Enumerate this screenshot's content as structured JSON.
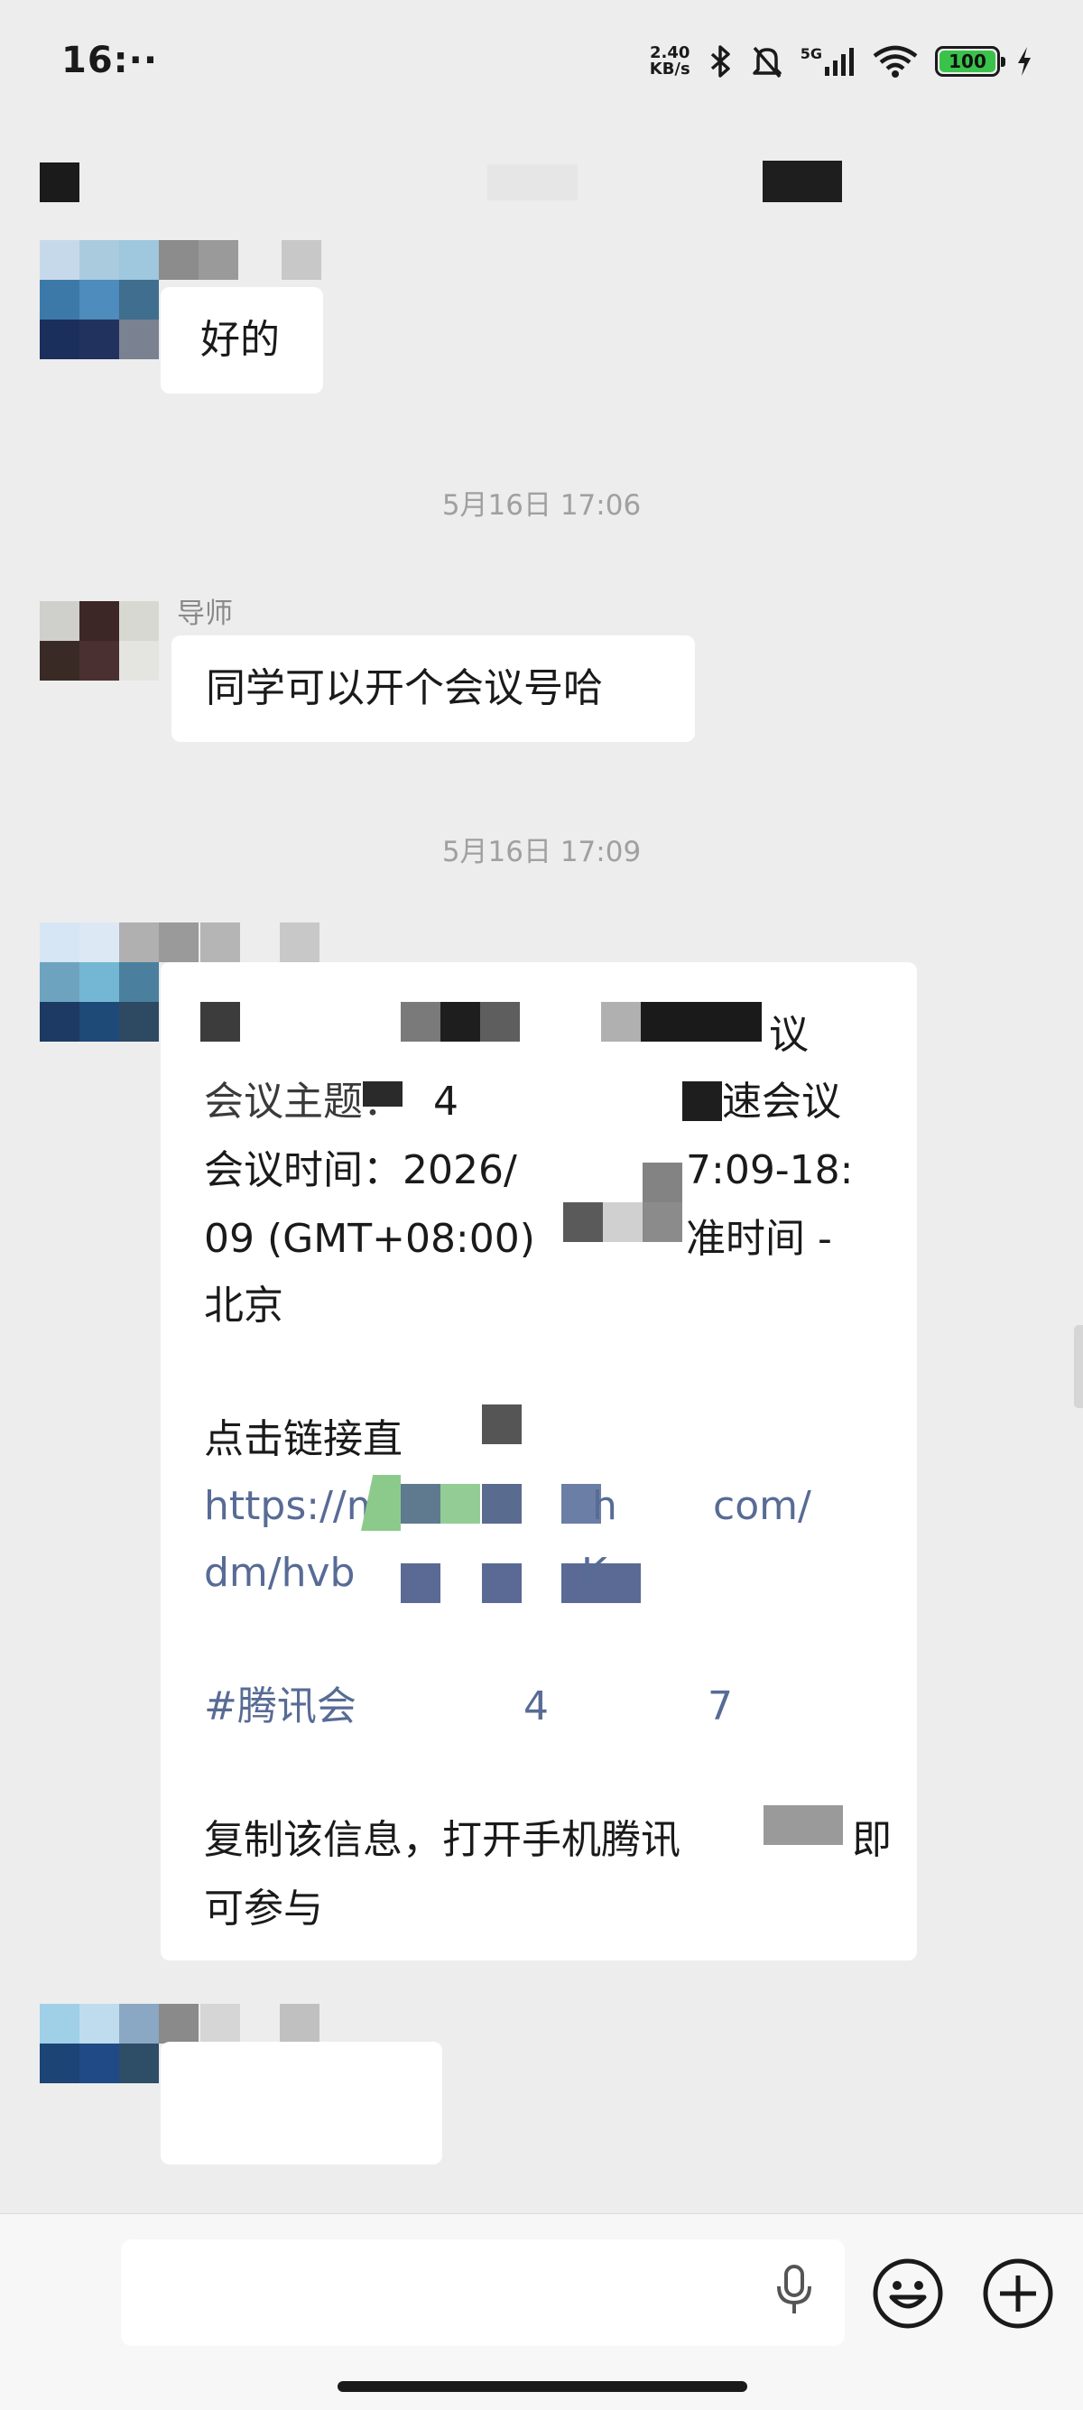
{
  "status_bar": {
    "time": "16:··",
    "net_speed_value": "2.40",
    "net_speed_unit": "KB/s",
    "network": "5G",
    "battery": "100",
    "icons": [
      "bluetooth-icon",
      "mute-bell-icon",
      "signal-icon",
      "wifi-icon",
      "battery-icon",
      "charging-icon"
    ]
  },
  "messages": [
    {
      "type": "text",
      "sender": "other",
      "text": "好的"
    },
    {
      "type": "time",
      "text": "5月16日 17:06"
    },
    {
      "type": "text",
      "sender": "other",
      "name": "导师",
      "text": "同学可以开个会议号哈"
    },
    {
      "type": "time",
      "text": "5月16日 17:09"
    },
    {
      "type": "meeting_card",
      "sender": "other",
      "line1_tail": "议",
      "line2_a": "会议主题：",
      "line2_b": "4",
      "line2_tail": "速会议",
      "line3_a": "会议时间：2026/",
      "line3_tail": "7:09-18:",
      "line4_a": "09 (GMT+08:00)",
      "line4_tail": "准时间 -",
      "line5": "北京",
      "line6": "点击链接直",
      "link1_a": "https://m",
      "link1_b": "h",
      "link1_tail": "com/",
      "link2": "dm/hvb",
      "link2_tail": "K",
      "tag_a": "#腾讯会",
      "tag_b": "4",
      "tag_tail": "7",
      "copy_a": "复制该信息，打开手机腾讯",
      "copy_tail": "即",
      "copy2": "可参与"
    },
    {
      "type": "blank",
      "sender": "other"
    }
  ],
  "colors": {
    "background": "#ededed",
    "bubble": "#ffffff",
    "link": "#576b95",
    "timestamp": "#a0a0a0"
  }
}
